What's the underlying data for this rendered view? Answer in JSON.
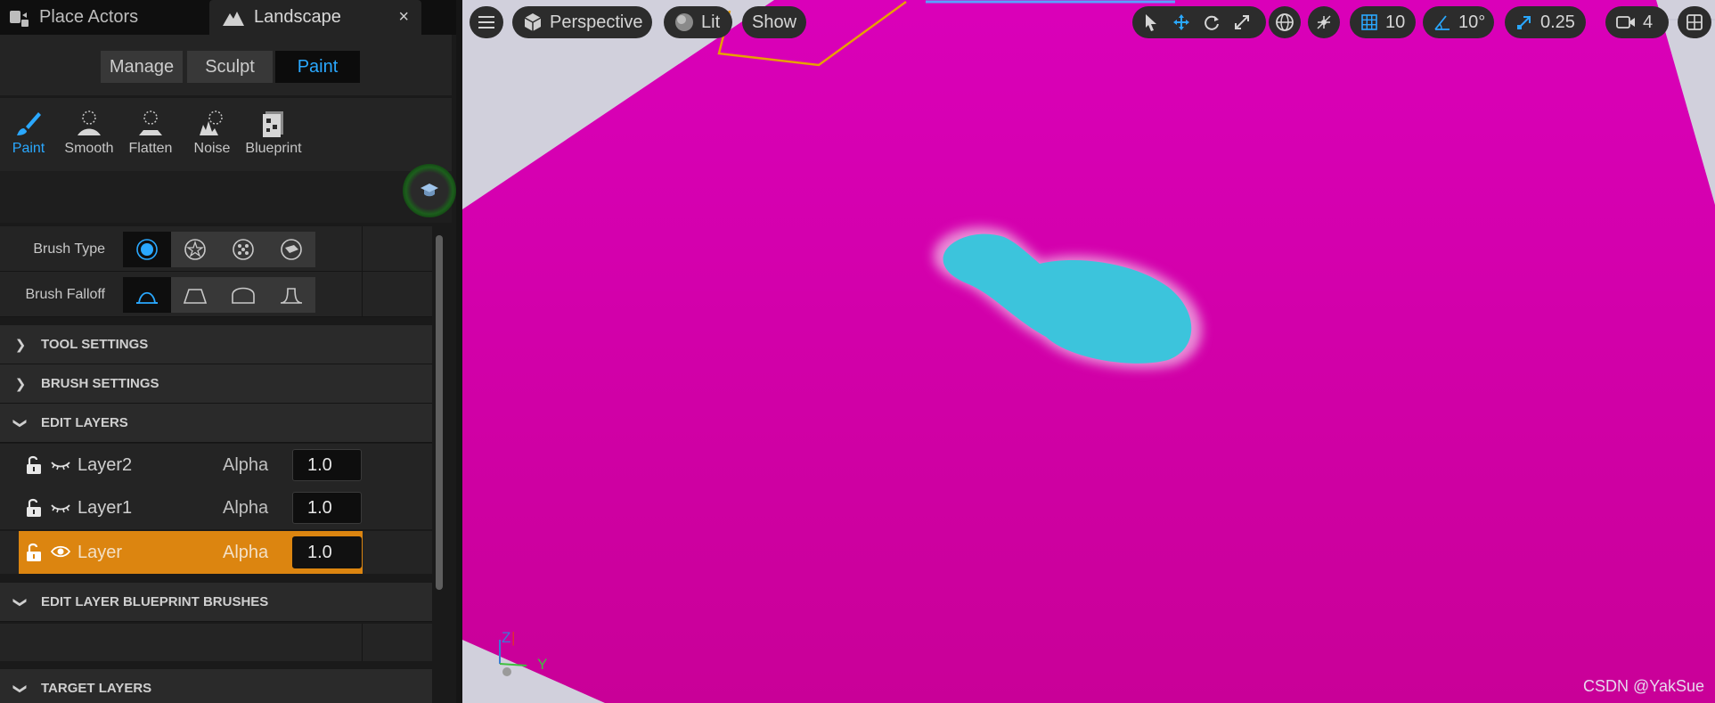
{
  "tabs": {
    "place_actors": "Place Actors",
    "landscape": "Landscape",
    "close_glyph": "×"
  },
  "modes": {
    "manage": "Manage",
    "sculpt": "Sculpt",
    "paint": "Paint",
    "active": "Paint"
  },
  "tools": {
    "paint": "Paint",
    "smooth": "Smooth",
    "flatten": "Flatten",
    "noise": "Noise",
    "blueprint": "Blueprint",
    "active": "Paint"
  },
  "brush": {
    "type_label": "Brush Type",
    "falloff_label": "Brush Falloff",
    "type_icons": [
      "brush-circle-icon",
      "brush-alpha-star-icon",
      "brush-pattern-icon",
      "brush-component-icon"
    ],
    "falloff_icons": [
      "falloff-smooth-icon",
      "falloff-linear-icon",
      "falloff-spherical-icon",
      "falloff-tip-icon"
    ]
  },
  "sections": {
    "tool_settings": "TOOL SETTINGS",
    "brush_settings": "BRUSH SETTINGS",
    "edit_layers": "EDIT LAYERS",
    "edit_layer_blueprint_brushes": "EDIT LAYER BLUEPRINT BRUSHES",
    "target_layers": "TARGET LAYERS"
  },
  "layers": [
    {
      "name": "Layer2",
      "alpha_label": "Alpha",
      "alpha": "1.0",
      "visible": false,
      "selected": false
    },
    {
      "name": "Layer1",
      "alpha_label": "Alpha",
      "alpha": "1.0",
      "visible": false,
      "selected": false
    },
    {
      "name": "Layer",
      "alpha_label": "Alpha",
      "alpha": "1.0",
      "visible": true,
      "selected": true
    }
  ],
  "viewport": {
    "perspective": "Perspective",
    "lit": "Lit",
    "show": "Show",
    "grid_snap": "10",
    "rotation_snap": "10°",
    "scale_snap": "0.25",
    "camera_speed": "4",
    "axis_z": "Z",
    "axis_y": "Y",
    "watermark": "CSDN @YakSue",
    "colors": {
      "landscape": "#d800b8",
      "painted_layer": "#3cc4dc",
      "accent": "#2aa8ff",
      "selection": "#dc8510"
    }
  }
}
